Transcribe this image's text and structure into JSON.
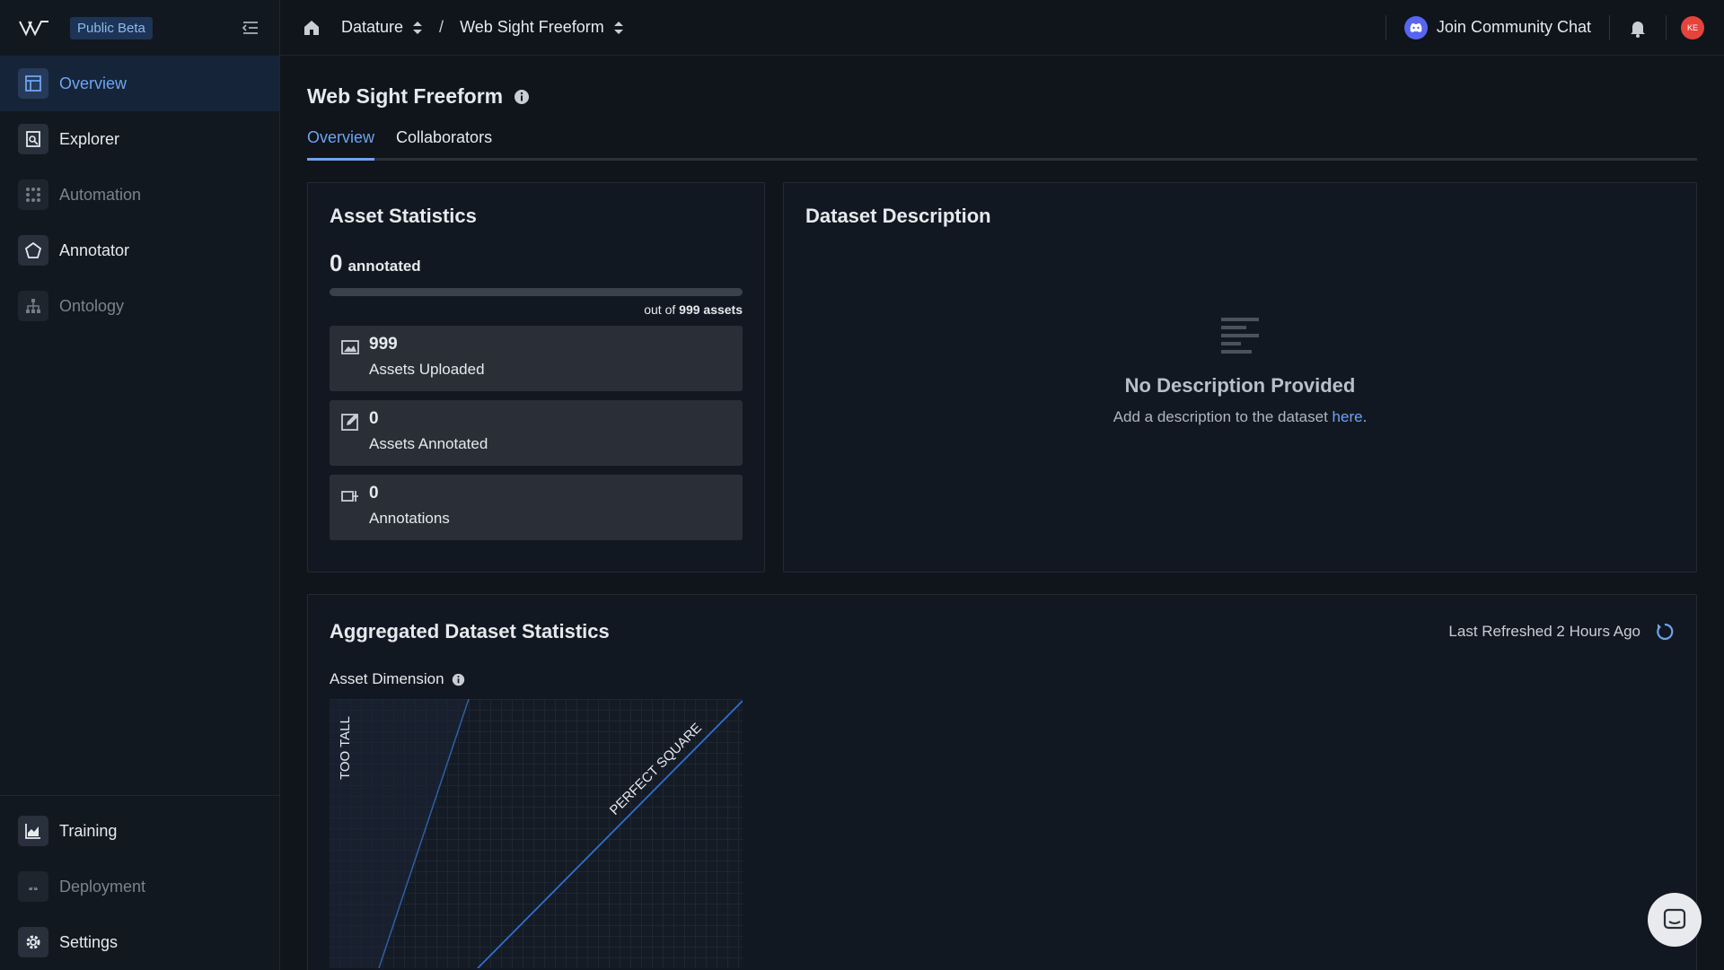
{
  "sidebar": {
    "beta_label": "Public Beta",
    "items": [
      {
        "label": "Overview",
        "icon": "overview-icon"
      },
      {
        "label": "Explorer",
        "icon": "explorer-icon"
      },
      {
        "label": "Automation",
        "icon": "automation-icon"
      },
      {
        "label": "Annotator",
        "icon": "annotator-icon"
      },
      {
        "label": "Ontology",
        "icon": "ontology-icon"
      }
    ],
    "bottom_items": [
      {
        "label": "Training",
        "icon": "training-icon"
      },
      {
        "label": "Deployment",
        "icon": "deployment-icon"
      },
      {
        "label": "Settings",
        "icon": "settings-icon"
      }
    ]
  },
  "topbar": {
    "crumbs": [
      "Datature",
      "Web Sight Freeform"
    ],
    "separator": "/",
    "chat_label": "Join Community Chat",
    "avatar_initials": "KE"
  },
  "page": {
    "title": "Web Sight Freeform",
    "tabs": [
      "Overview",
      "Collaborators"
    ]
  },
  "asset_stats": {
    "title": "Asset Statistics",
    "annotated_count": "0",
    "annotated_label": "annotated",
    "progress": 0,
    "out_of_prefix": "out of",
    "out_of_value": "999 assets",
    "stats": [
      {
        "value": "999",
        "label": "Assets Uploaded",
        "icon": "image-icon"
      },
      {
        "value": "0",
        "label": "Assets Annotated",
        "icon": "edit-icon"
      },
      {
        "value": "0",
        "label": "Annotations",
        "icon": "label-icon"
      }
    ]
  },
  "description": {
    "title": "Dataset Description",
    "empty_title": "No Description Provided",
    "empty_text": "Add a description to the dataset ",
    "link": "here",
    "end": "."
  },
  "aggregated": {
    "title": "Aggregated Dataset Statistics",
    "refreshed": "Last Refreshed 2 Hours Ago",
    "sub_title": "Asset Dimension",
    "plot_labels": {
      "tall": "TOO TALL",
      "square": "PERFECT SQUARE"
    }
  },
  "colors": {
    "accent": "#6ea4f0",
    "background": "#10141b",
    "card": "#121821"
  }
}
